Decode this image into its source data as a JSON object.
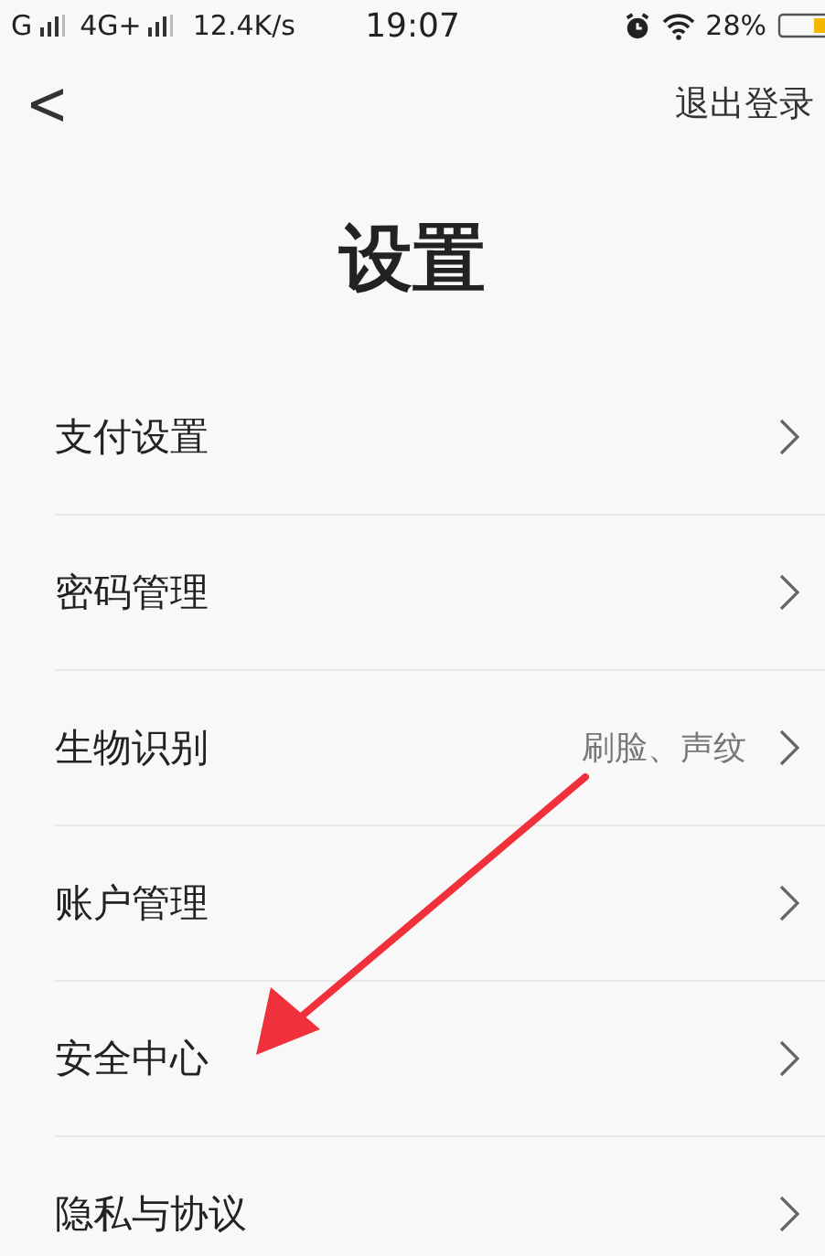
{
  "status_bar": {
    "signal_1": "G",
    "signal_2": "4G+",
    "speed": "12.4K/s",
    "time": "19:07",
    "battery": "28%"
  },
  "nav": {
    "back": "<",
    "action": "退出登录"
  },
  "title": "设置",
  "items": [
    {
      "label": "支付设置"
    },
    {
      "label": "密码管理"
    },
    {
      "label": "生物识别",
      "value": "刷脸、声纹"
    },
    {
      "label": "账户管理"
    },
    {
      "label": "安全中心"
    },
    {
      "label": "隐私与协议"
    }
  ]
}
